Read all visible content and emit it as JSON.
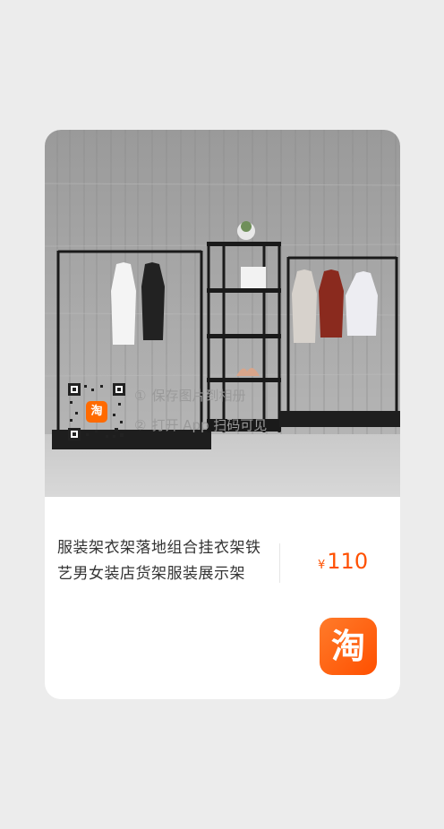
{
  "product": {
    "title": "服装架衣架落地组合挂衣架铁艺男女装店货架服装展示架",
    "price_symbol": "¥",
    "price": "110"
  },
  "share": {
    "qr_logo_char": "淘",
    "steps": [
      {
        "num": "①",
        "text": "保存图片到相册"
      },
      {
        "num": "②",
        "text": "打开 App 扫码可见"
      }
    ]
  },
  "brand": {
    "logo_char": "淘",
    "logo_color": "#ff5000"
  },
  "colors": {
    "price": "#ff5000",
    "page_bg": "#ececec",
    "card_bg": "#ffffff"
  }
}
